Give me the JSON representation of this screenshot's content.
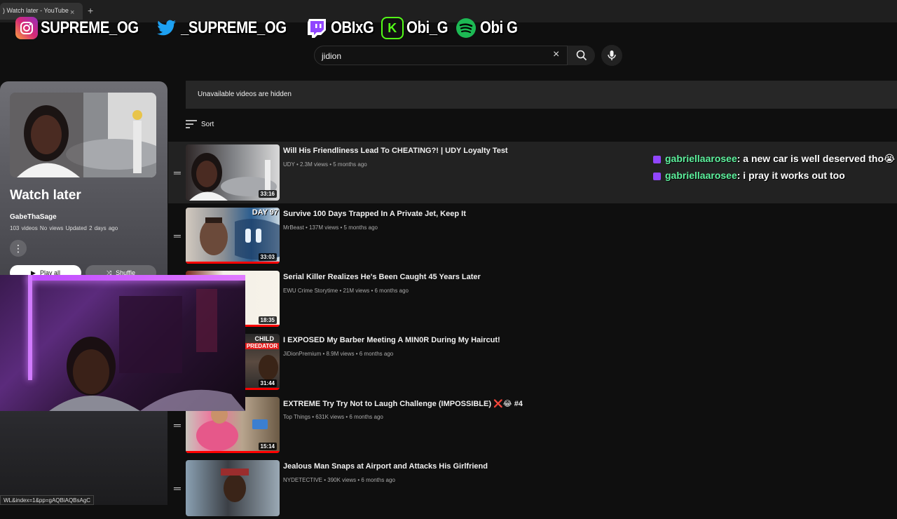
{
  "browser": {
    "tab_title": ") Watch later - YouTube",
    "tab_close": "×",
    "new_tab": "+"
  },
  "overlay": {
    "socials": [
      {
        "platform": "instagram",
        "icon": "instagram-icon",
        "handle": "SUPREME_OG"
      },
      {
        "platform": "twitter",
        "icon": "twitter-icon",
        "handle": "_SUPREME_OG"
      },
      {
        "platform": "twitch",
        "icon": "twitch-icon",
        "handle": "OBIxG"
      },
      {
        "platform": "kick",
        "icon": "kick-icon",
        "handle": "Obi_G"
      },
      {
        "platform": "spotify",
        "icon": "spotify-icon",
        "handle": "Obi G"
      }
    ]
  },
  "search": {
    "value": "jidion",
    "clear_icon": "×"
  },
  "playlist": {
    "title": "Watch later",
    "owner": "GabeThaSage",
    "meta": "103 videos  No views  Updated 2 days ago",
    "more_icon": "⋮",
    "play_all_label": "Play all",
    "shuffle_label": "Shuffle"
  },
  "notice": "Unavailable videos are hidden",
  "sort_label": "Sort",
  "videos": [
    {
      "title": "Will His Friendliness Lead To CHEATING?! | UDY Loyalty Test",
      "meta": "UDY • 2.3M views • 5 months ago",
      "duration": "33:16"
    },
    {
      "title": "Survive 100 Days Trapped In A Private Jet, Keep It",
      "meta": "MrBeast • 137M views • 5 months ago",
      "duration": "33:03"
    },
    {
      "title": "Serial Killer Realizes He's Been Caught 45 Years Later",
      "meta": "EWU Crime Storytime • 21M views • 6 months ago",
      "duration": "18:35"
    },
    {
      "title": "I EXPOSED My Barber Meeting A MIN0R During My Haircut!",
      "meta": "JiDionPremium • 8.9M views • 6 months ago",
      "duration": "31:44"
    },
    {
      "title": "EXTREME Try Try Not to Laugh Challenge (IMPOSSIBLE) ❌😂 #4",
      "meta": "Top Things • 631K views • 6 months ago",
      "duration": "15:14"
    },
    {
      "title": "Jealous Man Snaps at Airport and Attacks His Girlfriend",
      "meta": "NYDETECTIVE • 390K views • 6 months ago",
      "duration": ""
    }
  ],
  "chat": [
    {
      "user": "gabriellaarosee",
      "message": ": a new car is well deserved tho😭"
    },
    {
      "user": "gabriellaarosee",
      "message": ": i pray it works out too"
    }
  ],
  "thumb_labels": {
    "day97": "DAY 97",
    "child": "CHILD",
    "predator": "PREDATOR"
  },
  "status_url": "WL&index=1&pp=gAQBiAQBsAgC"
}
